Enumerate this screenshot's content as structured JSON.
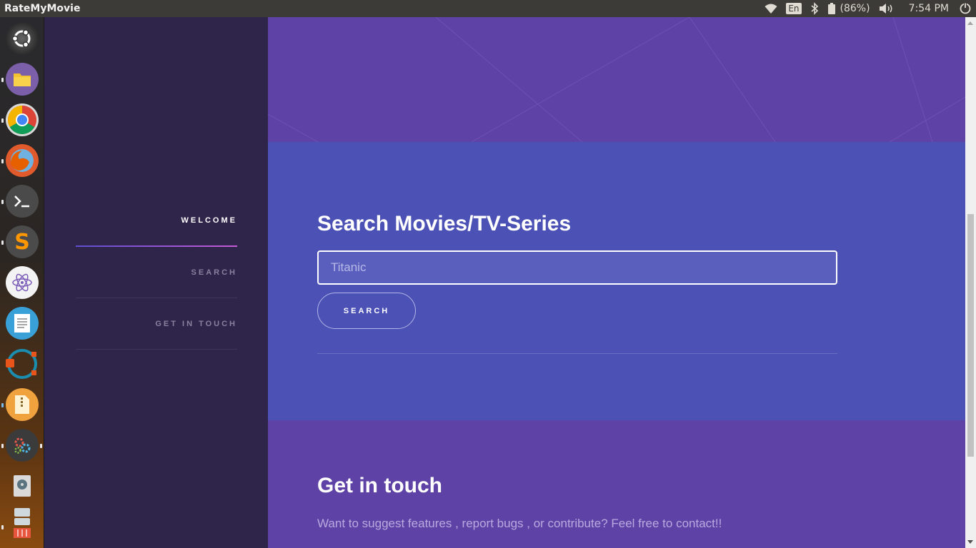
{
  "top_panel": {
    "app_title": "RateMyMovie",
    "language": "En",
    "battery": "(86%)",
    "clock": "7:54 PM"
  },
  "launcher": {
    "apps": [
      {
        "name": "ubuntu-dash-icon"
      },
      {
        "name": "files-icon"
      },
      {
        "name": "chrome-icon"
      },
      {
        "name": "firefox-icon"
      },
      {
        "name": "terminal-icon"
      },
      {
        "name": "sublime-text-icon"
      },
      {
        "name": "atom-icon"
      },
      {
        "name": "text-editor-icon"
      },
      {
        "name": "git-kraken-icon"
      },
      {
        "name": "archive-manager-icon"
      },
      {
        "name": "system-settings-icon"
      },
      {
        "name": "disk-icon"
      },
      {
        "name": "trash-icon"
      }
    ]
  },
  "sidebar": {
    "items": [
      {
        "label": "WELCOME"
      },
      {
        "label": "SEARCH"
      },
      {
        "label": "GET IN TOUCH"
      }
    ]
  },
  "search": {
    "heading": "Search Movies/TV-Series",
    "placeholder": "Titanic",
    "button_label": "SEARCH"
  },
  "contact": {
    "heading": "Get in touch",
    "text": "Want to suggest features , report bugs , or contribute? Feel free to contact!!"
  },
  "colors": {
    "sidebar_bg": "#2f2449",
    "purple_section": "#5e42a6",
    "blue_section": "#4c51b5"
  }
}
